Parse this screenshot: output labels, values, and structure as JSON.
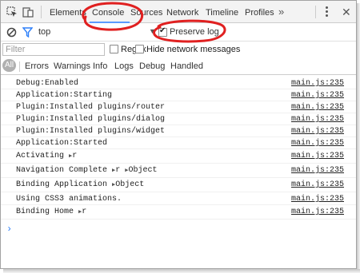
{
  "tabs": [
    {
      "label": "Elements"
    },
    {
      "label": "Console"
    },
    {
      "label": "Sources"
    },
    {
      "label": "Network"
    },
    {
      "label": "Timeline"
    },
    {
      "label": "Profiles"
    }
  ],
  "active_tab": "Console",
  "more_symbol": "»",
  "close_symbol": "✕",
  "context": {
    "value": "top",
    "caret": "▼"
  },
  "preserve_log": {
    "label": "Preserve log",
    "checked": true
  },
  "filter": {
    "placeholder": "Filter",
    "value": ""
  },
  "regex": {
    "label": "Regex",
    "checked": false
  },
  "hide_network": {
    "label": "Hide network messages",
    "checked": false
  },
  "levels": [
    "All",
    "Errors",
    "Warnings",
    "Info",
    "Logs",
    "Debug",
    "Handled"
  ],
  "console_rows": [
    {
      "text": "Debug:Enabled",
      "source": "main.js:235"
    },
    {
      "text": "Application:Starting",
      "source": "main.js:235"
    },
    {
      "text": "Plugin:Installed plugins/router",
      "source": "main.js:235"
    },
    {
      "text": "Plugin:Installed plugins/dialog",
      "source": "main.js:235"
    },
    {
      "text": "Plugin:Installed plugins/widget",
      "source": "main.js:235"
    },
    {
      "text": "Application:Started",
      "source": "main.js:235"
    },
    {
      "text": "Activating",
      "obj1": "r",
      "source": "main.js:235"
    },
    {
      "text": "Navigation Complete",
      "obj1": "r",
      "obj2": "Object",
      "source": "main.js:235"
    },
    {
      "text": "Binding Application",
      "obj1": "Object",
      "source": "main.js:235"
    },
    {
      "text": "Using CSS3 animations.",
      "source": "main.js:235"
    },
    {
      "text": "Binding Home",
      "obj1": "r",
      "source": "main.js:235"
    }
  ],
  "prompt_symbol": "›",
  "colors": {
    "annotation": "#e02020",
    "tab_active_underline": "#5a9bff",
    "prompt": "#2d7ff9"
  }
}
